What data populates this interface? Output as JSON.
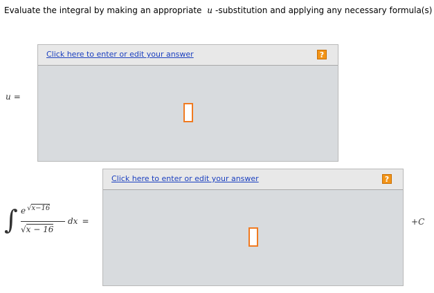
{
  "prompt": {
    "before": "Evaluate the integral by making an appropriate",
    "variable": "u",
    "after": "-substitution and applying any necessary formula(s)"
  },
  "u_label": {
    "var": "u",
    "eq": "="
  },
  "answer_panels": [
    {
      "link_text": "Click here to enter or edit your answer",
      "help_icon": "?"
    },
    {
      "link_text": "Click here to enter or edit your answer",
      "help_icon": "?"
    }
  ],
  "integral": {
    "sign": "∫",
    "num_base": "e",
    "num_exp_sqrt": "√",
    "num_exp_rad": "x−16",
    "den_sqrt": "√",
    "den_rad": "x − 16",
    "dx": "dx",
    "eq": "="
  },
  "constant": {
    "plus": "+",
    "c": "C"
  },
  "colors": {
    "link": "#1a3fbf",
    "help_bg": "#f29418",
    "cursor_border": "#f07a20",
    "panel_bg": "#d8dbde"
  }
}
